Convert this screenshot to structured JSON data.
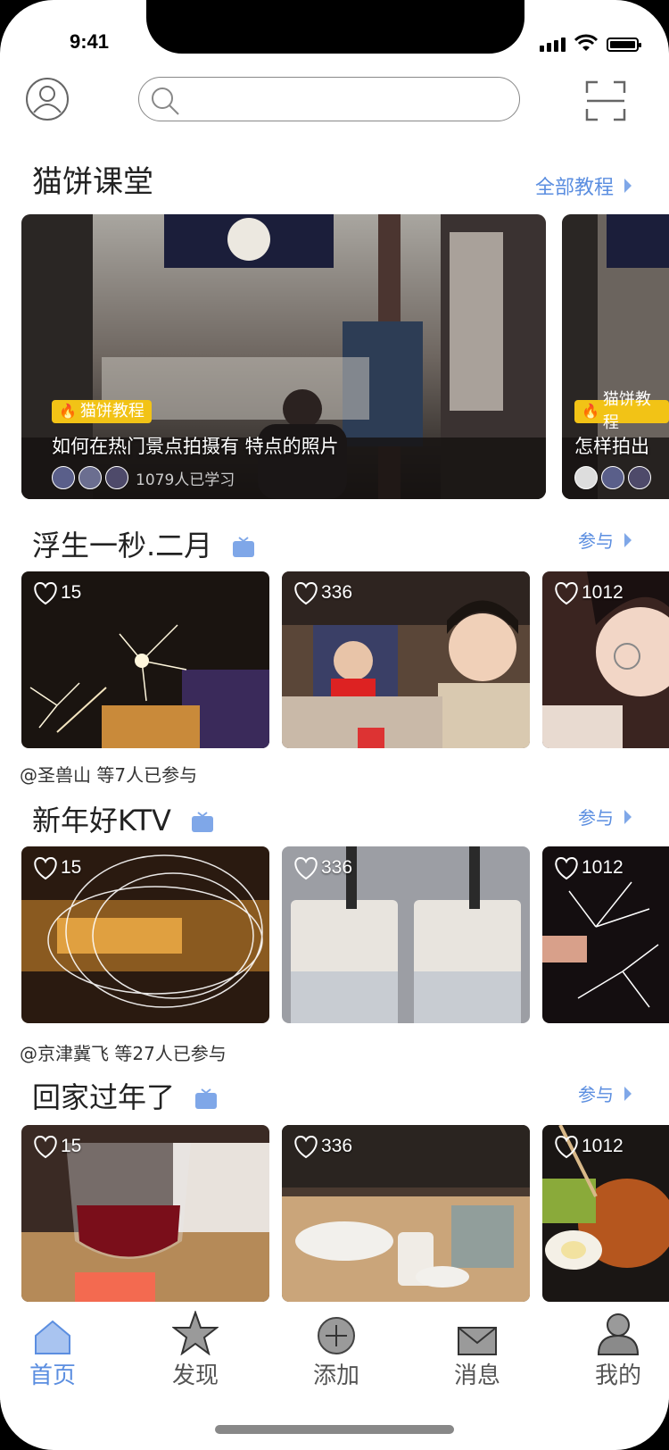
{
  "status_bar": {
    "time": "9:41"
  },
  "header": {
    "search": {
      "placeholder": ""
    }
  },
  "tutorials": {
    "title": "猫饼课堂",
    "more_label": "全部教程",
    "cards": [
      {
        "tag": "猫饼教程",
        "title": "如何在热门景点拍摄有 特点的照片",
        "learners": "1079人已学习"
      },
      {
        "tag": "猫饼教程",
        "title": "怎样拍出",
        "learners": ""
      }
    ]
  },
  "topics": [
    {
      "title": "浮生一秒.二月",
      "join_label": "参与",
      "photos": [
        {
          "likes": "15"
        },
        {
          "likes": "336"
        },
        {
          "likes": "1012"
        }
      ],
      "participants": "@圣兽山 等7人已参与"
    },
    {
      "title": "新年好KTV",
      "join_label": "参与",
      "photos": [
        {
          "likes": "15"
        },
        {
          "likes": "336"
        },
        {
          "likes": "1012"
        }
      ],
      "participants": "@京津冀飞 等27人已参与"
    },
    {
      "title": "回家过年了",
      "join_label": "参与",
      "photos": [
        {
          "likes": "15"
        },
        {
          "likes": "336"
        },
        {
          "likes": "1012"
        }
      ],
      "participants": ""
    }
  ],
  "tabbar": {
    "items": [
      {
        "label": "首页",
        "icon": "home-icon",
        "active": true
      },
      {
        "label": "发现",
        "icon": "star-icon",
        "active": false
      },
      {
        "label": "添加",
        "icon": "plus-circle-icon",
        "active": false
      },
      {
        "label": "消息",
        "icon": "mail-icon",
        "active": false
      },
      {
        "label": "我的",
        "icon": "person-icon",
        "active": false
      }
    ]
  },
  "colors": {
    "accent": "#5b8ee0",
    "tag_yellow": "#f2c316"
  }
}
